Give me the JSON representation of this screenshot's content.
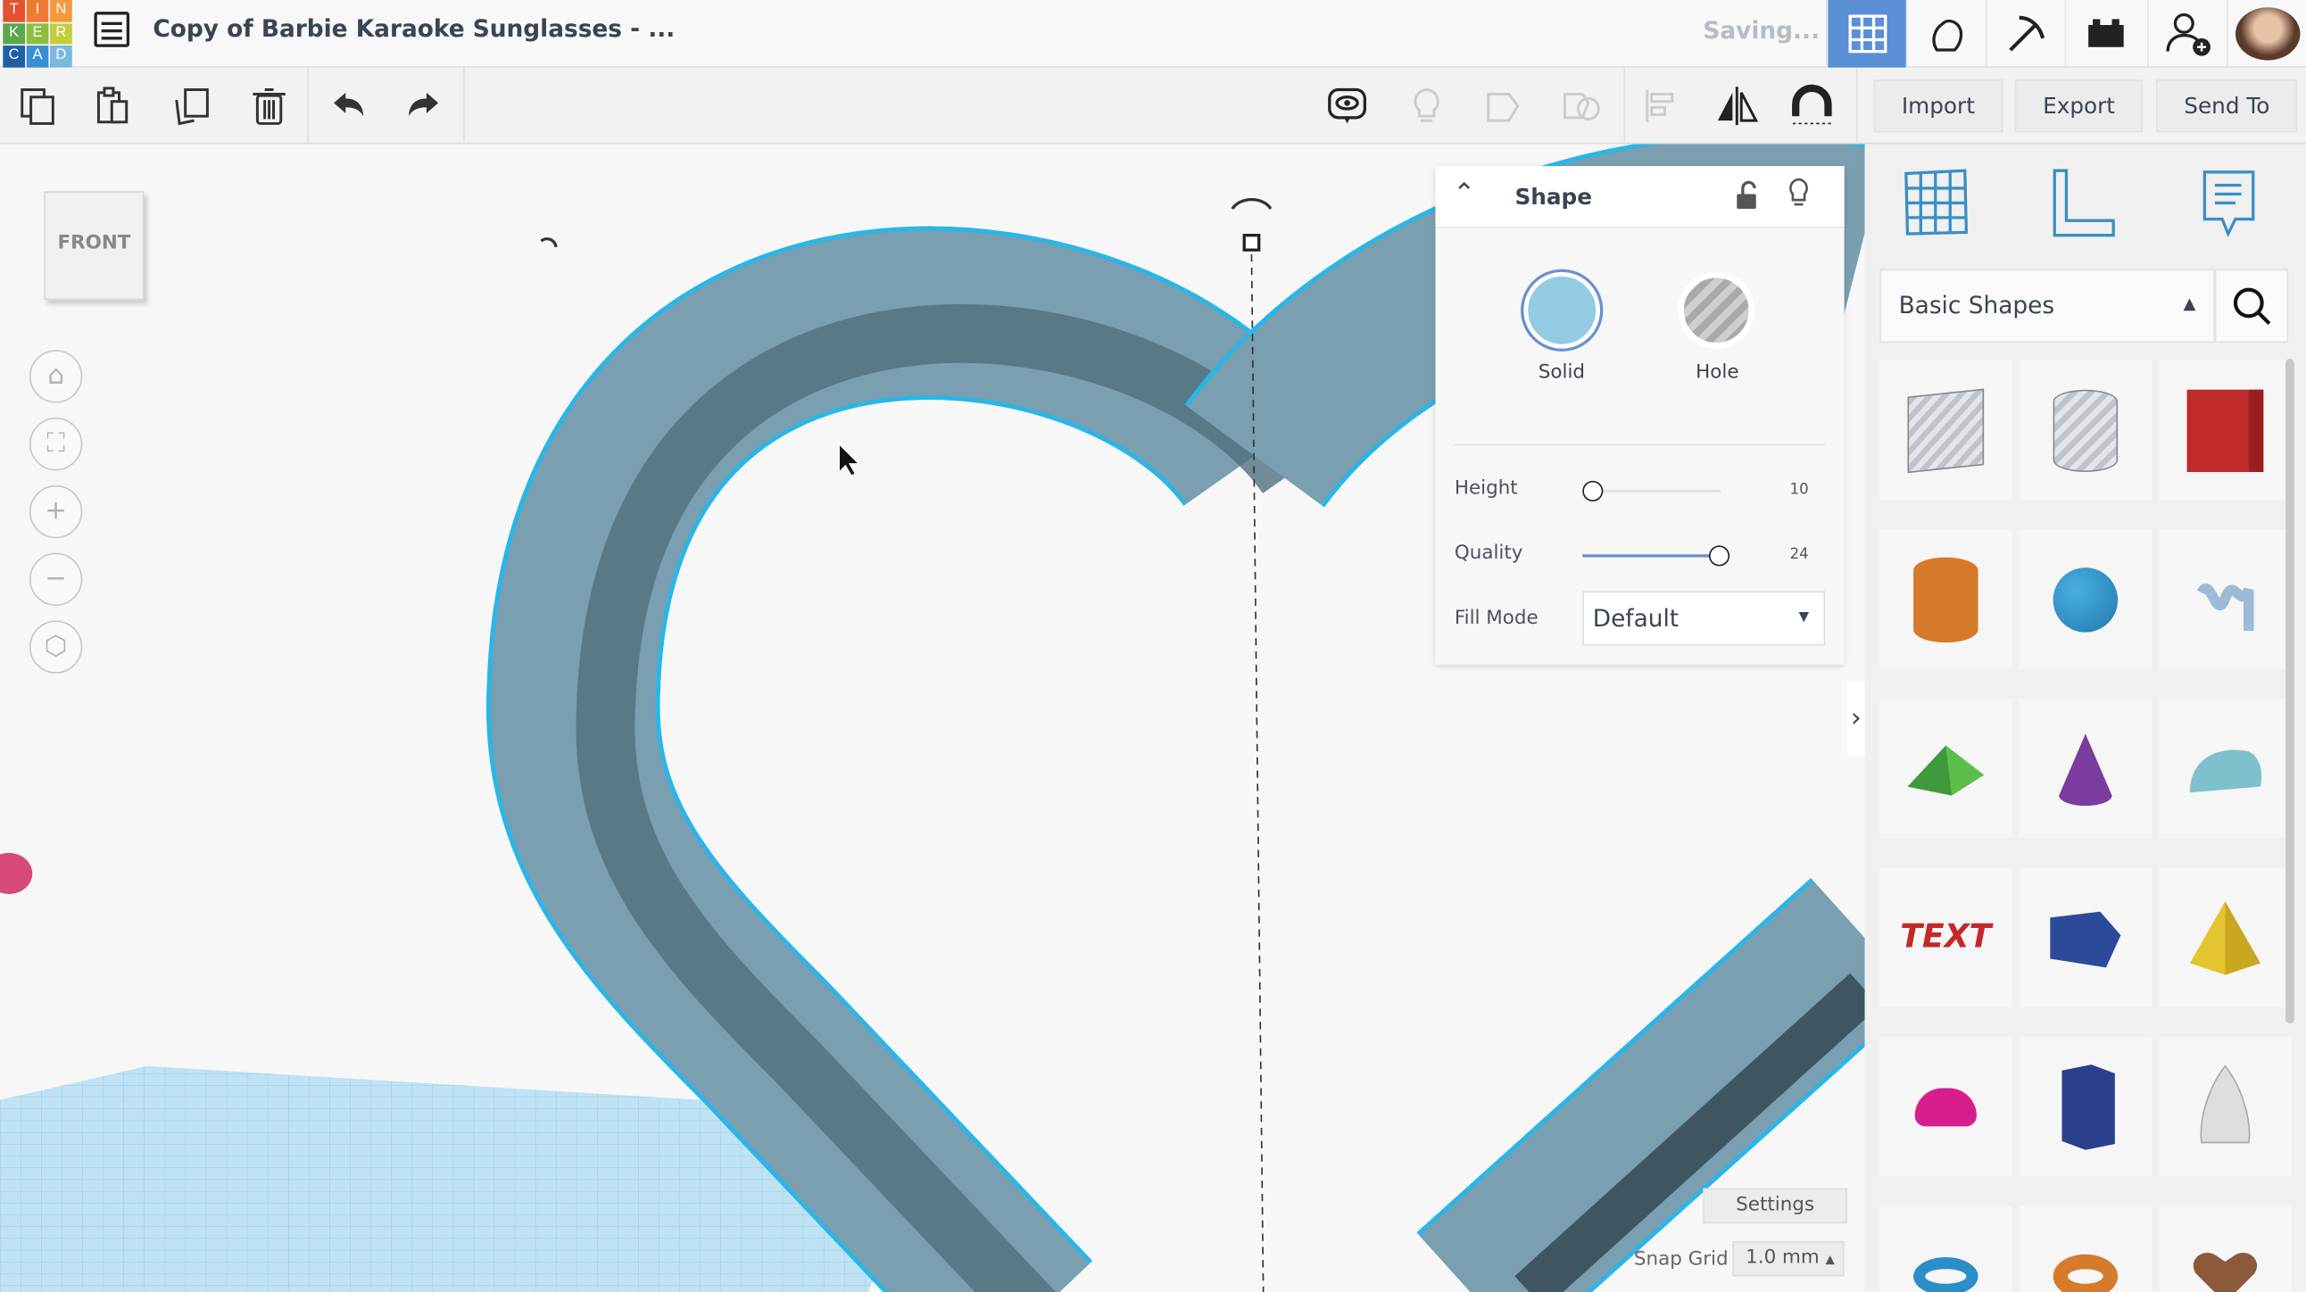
{
  "logo": {
    "letters": [
      "T",
      "I",
      "N",
      "K",
      "E",
      "R",
      "C",
      "A",
      "D"
    ]
  },
  "header": {
    "title": "Copy of Barbie Karaoke Sunglasses - ...",
    "status": "Saving..."
  },
  "toolbar": {
    "import": "Import",
    "export": "Export",
    "send_to": "Send To"
  },
  "viewcube": {
    "face": "FRONT"
  },
  "inspector": {
    "title": "Shape",
    "solid": "Solid",
    "hole": "Hole",
    "height_label": "Height",
    "height_value": "10",
    "height_fraction": 0.0,
    "quality_label": "Quality",
    "quality_value": "24",
    "quality_fraction": 1.0,
    "fill_label": "Fill Mode",
    "fill_value": "Default"
  },
  "library": {
    "category": "Basic Shapes"
  },
  "footer": {
    "settings": "Settings",
    "snap_label": "Snap Grid",
    "snap_value": "1.0 mm"
  },
  "colors": {
    "accent": "#4a90d9",
    "shape": "#7a9fb1",
    "selection": "#2ab6e8"
  }
}
